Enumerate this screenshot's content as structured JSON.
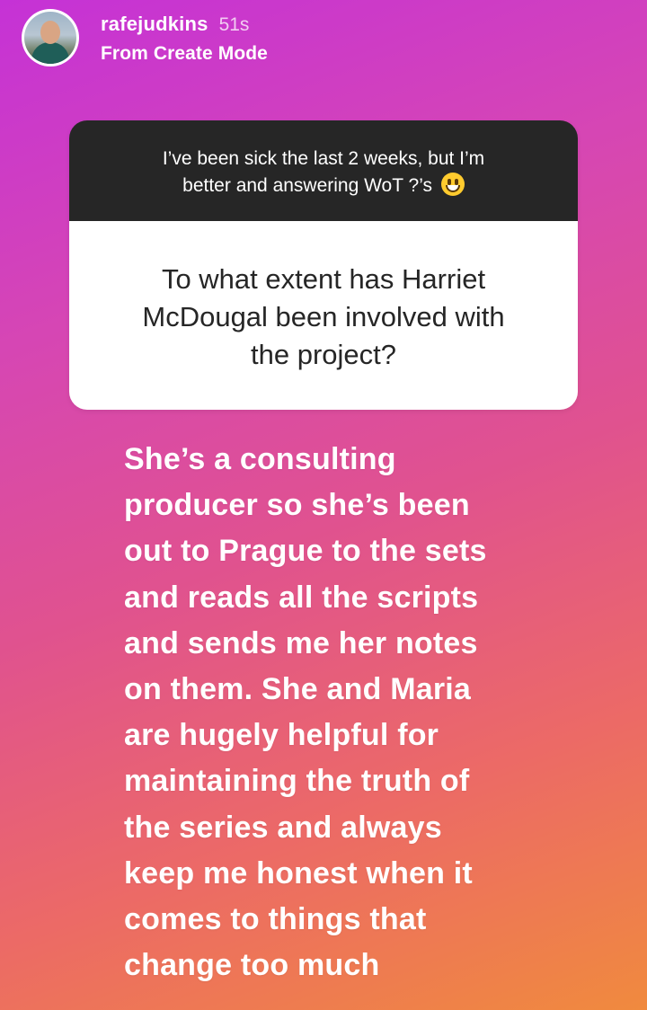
{
  "header": {
    "username": "rafejudkins",
    "timestamp": "51s",
    "subtitle": "From Create Mode"
  },
  "card": {
    "prompt_line1": "I’ve been sick the last 2 weeks, but I’m",
    "prompt_line2": "better and answering WoT ?’s",
    "prompt_emoji": "grinning-face-emoji",
    "question_lines": [
      "To what extent has Harriet",
      "McDougal been involved with",
      "the project?"
    ]
  },
  "answer": {
    "lines": [
      "She’s a consulting",
      "producer so she’s been",
      "out to Prague to the sets",
      "and reads all the scripts",
      "and sends me her notes",
      "on them.  She and Maria",
      "are hugely helpful for",
      "maintaining the truth of",
      "the series and always",
      "keep me honest when it",
      "comes to things that",
      "change too much"
    ]
  },
  "colors": {
    "gradient_start": "#c532d6",
    "gradient_end": "#f08a3e",
    "prompt_background": "#262626",
    "question_background": "#ffffff"
  }
}
